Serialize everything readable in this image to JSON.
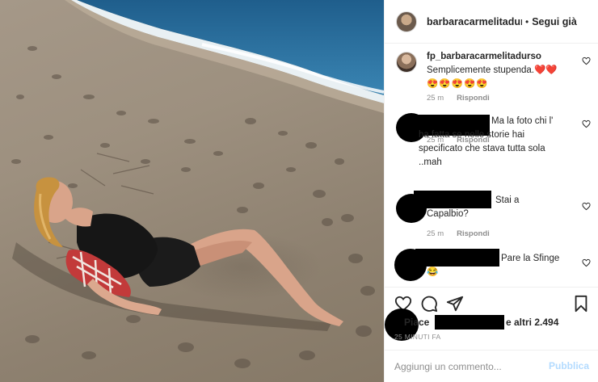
{
  "post": {
    "header": {
      "username": "barbaracarmelitadurso",
      "separator": "•",
      "follow_label": "Segui già",
      "avatar_icon": "profile-avatar"
    },
    "comments": [
      {
        "username": "fp_barbaracarmelitadurso",
        "text": "Semplicemente stupenda.",
        "hearts": "❤️❤️",
        "emoji_line": "😍😍😍😍😍",
        "time": "25 m",
        "reply_label": "Rispondi",
        "avatar": "profile-photo"
      },
      {
        "username": "",
        "text_line1": "Ma la foto chi l'",
        "text_line2": "ha fatta se nelle storie hai",
        "text_line3": "specificato che stava tutta sola",
        "text_line4": "..mah",
        "time": "25 m",
        "reply_label": "Rispondi",
        "avatar": "redacted"
      },
      {
        "username": "",
        "text_line1": "Stai a",
        "text_line2": "Capalbio?",
        "time": "25 m",
        "reply_label": "Rispondi",
        "avatar": "redacted"
      },
      {
        "username": "",
        "text_line1": "Pare la Sfinge",
        "emoji": "😂",
        "avatar": "redacted"
      }
    ],
    "actions": {
      "like_icon": "heart-outline",
      "comment_icon": "speech-bubble",
      "share_icon": "paper-plane",
      "save_icon": "bookmark"
    },
    "likes": {
      "prefix": "Piace",
      "suffix": "e altri 2.494"
    },
    "time_ago": "25 MINUTI FA",
    "add_comment": {
      "placeholder": "Aggiungi un commento...",
      "publish_label": "Pubblica"
    },
    "colors": {
      "accent_disabled": "#b3dbff",
      "heart_red": "#ed4956",
      "muted": "#8e8e8e",
      "text": "#262626"
    }
  }
}
